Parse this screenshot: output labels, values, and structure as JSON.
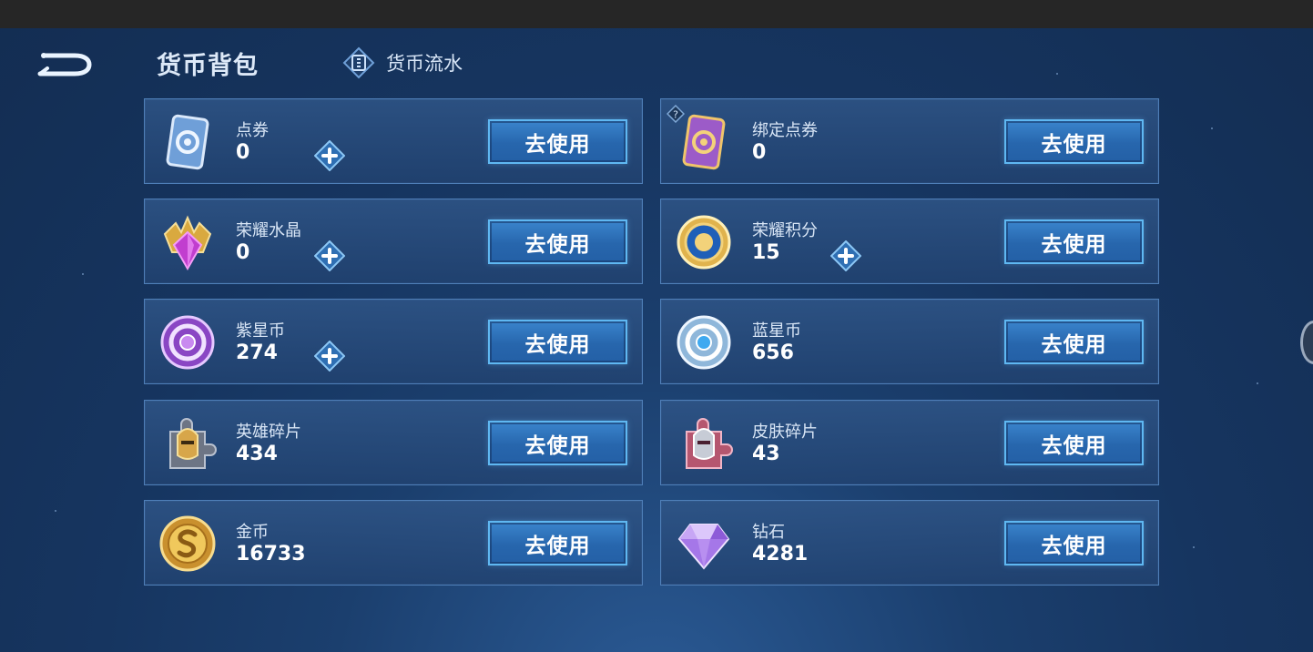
{
  "header": {
    "title": "货币背包",
    "flow_tab_label": "货币流水"
  },
  "cards": [
    {
      "name": "点券",
      "value": "0",
      "button": "去使用",
      "icon": "voucher-icon",
      "has_plus": true
    },
    {
      "name": "绑定点券",
      "value": "0",
      "button": "去使用",
      "icon": "bound-voucher-icon",
      "has_help": true
    },
    {
      "name": "荣耀水晶",
      "value": "0",
      "button": "去使用",
      "icon": "glory-crystal-icon",
      "has_plus": true
    },
    {
      "name": "荣耀积分",
      "value": "15",
      "button": "去使用",
      "icon": "glory-points-icon",
      "has_plus": true
    },
    {
      "name": "紫星币",
      "value": "274",
      "button": "去使用",
      "icon": "purple-star-coin-icon",
      "has_plus": true
    },
    {
      "name": "蓝星币",
      "value": "656",
      "button": "去使用",
      "icon": "blue-star-coin-icon"
    },
    {
      "name": "英雄碎片",
      "value": "434",
      "button": "去使用",
      "icon": "hero-fragment-icon"
    },
    {
      "name": "皮肤碎片",
      "value": "43",
      "button": "去使用",
      "icon": "skin-fragment-icon"
    },
    {
      "name": "金币",
      "value": "16733",
      "button": "去使用",
      "icon": "gold-coin-icon"
    },
    {
      "name": "钻石",
      "value": "4281",
      "button": "去使用",
      "icon": "diamond-icon"
    }
  ],
  "colors": {
    "background": "#163560",
    "card": "#2a4f82",
    "card_border": "#4f7fb8",
    "button": "#2c6fb8",
    "button_border": "#5fb8f2"
  }
}
